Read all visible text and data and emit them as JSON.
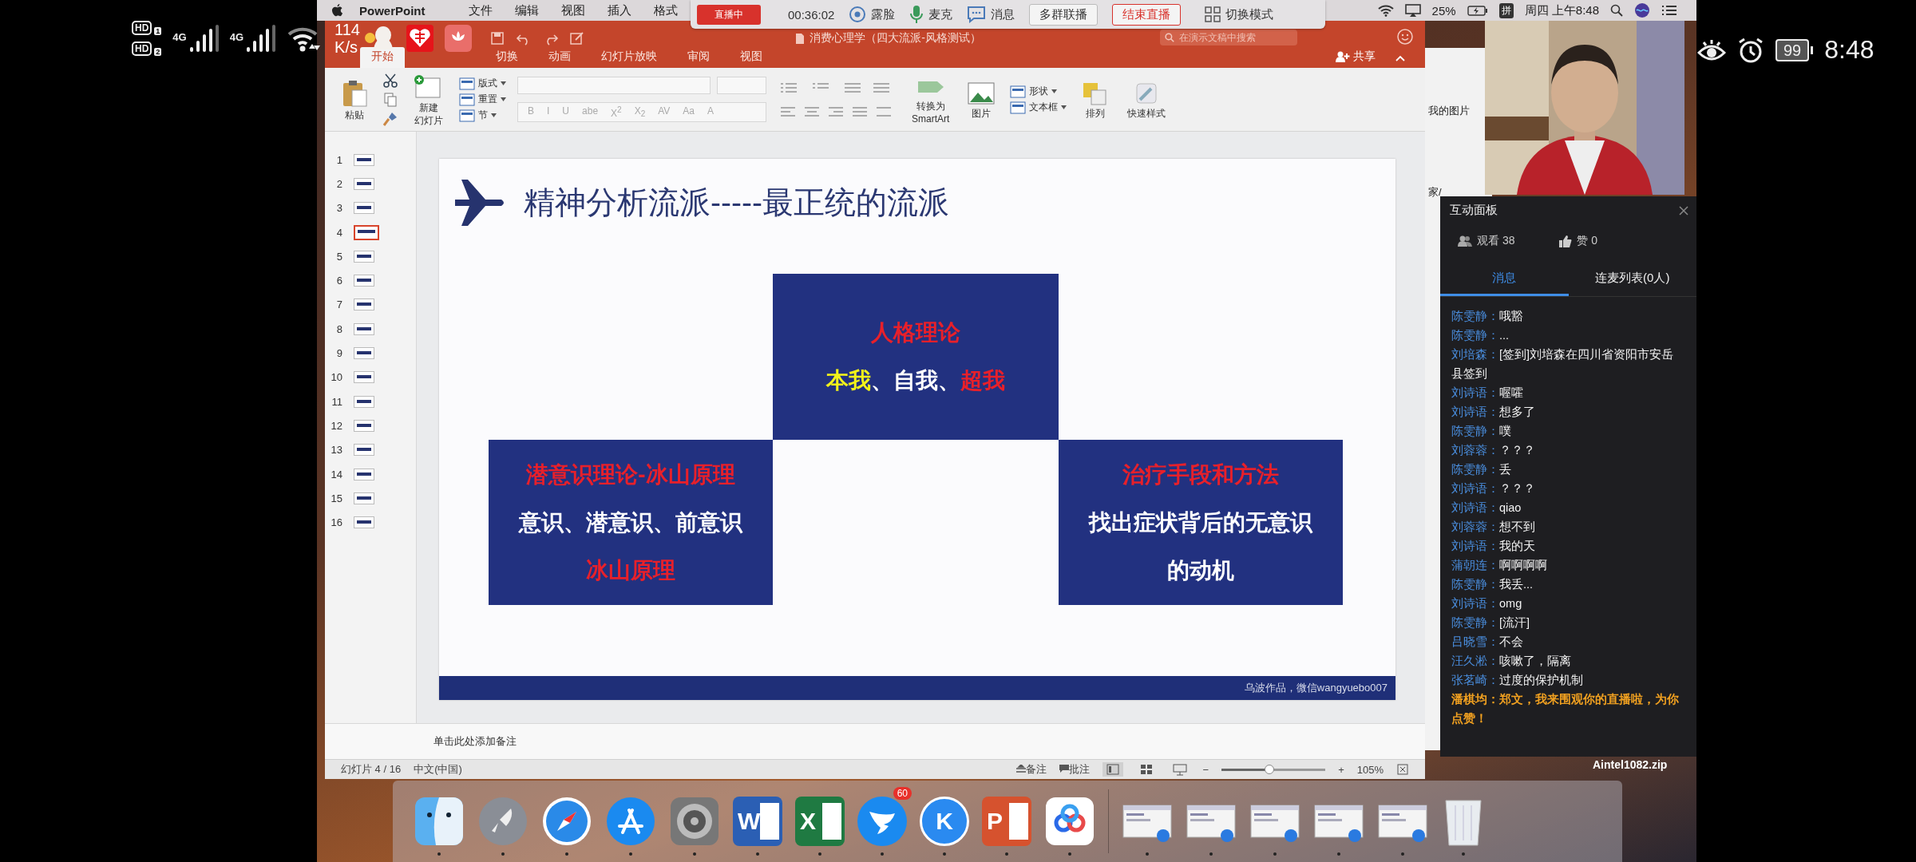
{
  "phone_status": {
    "sims": [
      {
        "label": "HD",
        "slot": "1"
      },
      {
        "label": "HD",
        "slot": "2"
      }
    ],
    "networks": [
      "4G",
      "4G"
    ],
    "speed_value": "114",
    "speed_unit": "K/s",
    "battery": "99",
    "time": "8:48"
  },
  "menu_bar": {
    "app": "PowerPoint",
    "items": [
      "文件",
      "编辑",
      "视图",
      "插入",
      "格式"
    ],
    "battery": "25%",
    "input_method": "拼",
    "clock": "周四 上午8:48"
  },
  "live_toolbar": {
    "status": "直播中",
    "timer": "00:36:02",
    "actions": [
      {
        "kind": "camera",
        "label": "露脸"
      },
      {
        "kind": "mic",
        "label": "麦克"
      },
      {
        "kind": "message",
        "label": "消息"
      }
    ],
    "buttons": [
      {
        "kind": "plain",
        "label": "多群联播"
      },
      {
        "kind": "danger",
        "label": "结束直播"
      },
      {
        "kind": "layout",
        "label": "切换模式"
      }
    ]
  },
  "ppt": {
    "title": "消费心理学（四大流派-风格测试）",
    "search": {
      "placeholder": "在演示文稿中搜索"
    },
    "tabs": [
      {
        "label": "开始",
        "selected": true
      },
      {
        "label": "切换",
        "selected": false
      },
      {
        "label": "动画",
        "selected": false
      },
      {
        "label": "幻灯片放映",
        "selected": false
      },
      {
        "label": "审阅",
        "selected": false
      },
      {
        "label": "视图",
        "selected": false
      }
    ],
    "share": "共享",
    "ribbon": [
      {
        "kind": "big",
        "lines": [
          "粘贴"
        ]
      },
      {
        "kind": "tools"
      },
      {
        "kind": "big",
        "lines": [
          "新建",
          "幻灯片"
        ]
      },
      {
        "kind": "stack",
        "items": [
          "版式",
          "重置",
          "节"
        ]
      },
      {
        "kind": "font",
        "items": [
          "B",
          "I",
          "U",
          "abe",
          "X$^{2}$",
          "X$_{2}$",
          "AV",
          "Aa",
          "A"
        ]
      },
      {
        "kind": "paragraph"
      },
      {
        "kind": "big",
        "lines": [
          "转换为",
          "SmartArt"
        ]
      },
      {
        "kind": "big",
        "lines": [
          "图片"
        ]
      },
      {
        "kind": "stack",
        "items": [
          "形状",
          "文本框"
        ]
      },
      {
        "kind": "big",
        "lines": [
          "排列"
        ]
      },
      {
        "kind": "big",
        "lines": [
          "快速样式"
        ]
      }
    ],
    "thumbnails": [
      {
        "number": "1",
        "selected": false
      },
      {
        "number": "2",
        "selected": false
      },
      {
        "number": "3",
        "selected": false
      },
      {
        "number": "4",
        "selected": true
      },
      {
        "number": "5",
        "selected": false
      },
      {
        "number": "6",
        "selected": false
      },
      {
        "number": "7",
        "selected": false
      },
      {
        "number": "8",
        "selected": false
      },
      {
        "number": "9",
        "selected": false
      },
      {
        "number": "10",
        "selected": false
      },
      {
        "number": "11",
        "selected": false
      },
      {
        "number": "12",
        "selected": false
      },
      {
        "number": "13",
        "selected": false
      },
      {
        "number": "14",
        "selected": false
      },
      {
        "number": "15",
        "selected": false
      },
      {
        "number": "16",
        "selected": false
      }
    ],
    "slide": {
      "title": "精神分析流派-----最正统的流派",
      "top_box": {
        "lines": [
          [
            {
              "text": "人格理论",
              "color": "#e8202a"
            }
          ],
          [
            {
              "text": "本我",
              "color": "#f2f21a"
            },
            {
              "text": "、自我、",
              "color": "#ffffff"
            },
            {
              "text": "超我",
              "color": "#e8202a"
            }
          ]
        ]
      },
      "bottom_boxes": [
        {
          "lines": [
            [
              {
                "text": "潜意识理论-冰山原理",
                "color": "#e8202a"
              }
            ],
            [
              {
                "text": "意识、潜意识、前意识",
                "color": "#ffffff"
              }
            ],
            [
              {
                "text": "冰山原理",
                "color": "#e8202a"
              }
            ]
          ]
        },
        {
          "lines": [
            [
              {
                "text": "治疗手段和方法",
                "color": "#e8202a"
              }
            ],
            [
              {
                "text": "找出症状背后的无意识的动机",
                "color": "#ffffff"
              }
            ]
          ]
        }
      ],
      "footer": "乌波作品，微信wangyuebo007"
    },
    "notes": {
      "text": "单击此处添加备注"
    },
    "status_bar": {
      "slide": "幻灯片 4 / 16",
      "language": "中文(中国)",
      "notes": "备注",
      "comments": "批注",
      "zoom_out": "−",
      "zoom": {
        "level": 0.45
      },
      "zoom_in": "+",
      "zoom_value": "105%"
    }
  },
  "background_window": {
    "texts": [
      "我的图片",
      "家/"
    ]
  },
  "chat": {
    "title": "互动面板",
    "viewers": "观看 38",
    "likes": "赞 0",
    "tabs": [
      {
        "label": "消息",
        "selected": true
      },
      {
        "label": "连麦列表(0人)",
        "selected": false
      }
    ],
    "messages": [
      {
        "kind": "normal",
        "user": "陈雯静：",
        "text": "哦豁"
      },
      {
        "kind": "normal",
        "user": "陈雯静：",
        "text": "..."
      },
      {
        "kind": "normal",
        "user": "刘培森：",
        "text": "[签到]刘培森在四川省资阳市安岳县签到"
      },
      {
        "kind": "normal",
        "user": "刘诗语：",
        "text": "喔嚯"
      },
      {
        "kind": "normal",
        "user": "刘诗语：",
        "text": "想多了"
      },
      {
        "kind": "normal",
        "user": "陈雯静：",
        "text": "噗"
      },
      {
        "kind": "normal",
        "user": "刘蓉蓉：",
        "text": "？？？"
      },
      {
        "kind": "normal",
        "user": "陈雯静：",
        "text": "丢"
      },
      {
        "kind": "normal",
        "user": "刘诗语：",
        "text": "？？？"
      },
      {
        "kind": "normal",
        "user": "刘诗语：",
        "text": "qiao"
      },
      {
        "kind": "normal",
        "user": "刘蓉蓉：",
        "text": "想不到"
      },
      {
        "kind": "normal",
        "user": "刘诗语：",
        "text": "我的天"
      },
      {
        "kind": "normal",
        "user": "蒲朝连：",
        "text": "啊啊啊啊"
      },
      {
        "kind": "normal",
        "user": "陈雯静：",
        "text": "我丢..."
      },
      {
        "kind": "normal",
        "user": "刘诗语：",
        "text": "omg"
      },
      {
        "kind": "normal",
        "user": "陈雯静：",
        "text": "[流汗]"
      },
      {
        "kind": "normal",
        "user": "吕晓雪：",
        "text": "不会"
      },
      {
        "kind": "normal",
        "user": "汪久淞：",
        "text": "咳嗽了，隔离"
      },
      {
        "kind": "normal",
        "user": "张茗崎：",
        "text": "过度的保护机制"
      },
      {
        "kind": "highlight",
        "user": "潘棋均：",
        "text": "郑文，我来围观你的直播啦，为你点赞！"
      }
    ]
  },
  "desktop": {
    "file": "Aintel1082.zip"
  },
  "dock": [
    {
      "kind": "finder"
    },
    {
      "kind": "launchpad"
    },
    {
      "kind": "safari"
    },
    {
      "kind": "appstore"
    },
    {
      "kind": "settings"
    },
    {
      "kind": "word",
      "glyph": "W"
    },
    {
      "kind": "excel",
      "glyph": "X"
    },
    {
      "kind": "messenger",
      "badge": "60"
    },
    {
      "kind": "kapp",
      "glyph": "K"
    },
    {
      "kind": "powerpoint",
      "glyph": "P"
    },
    {
      "kind": "cloud"
    },
    {
      "kind": "divider"
    },
    {
      "kind": "window"
    },
    {
      "kind": "window"
    },
    {
      "kind": "window"
    },
    {
      "kind": "window"
    },
    {
      "kind": "window"
    },
    {
      "kind": "trash"
    }
  ]
}
